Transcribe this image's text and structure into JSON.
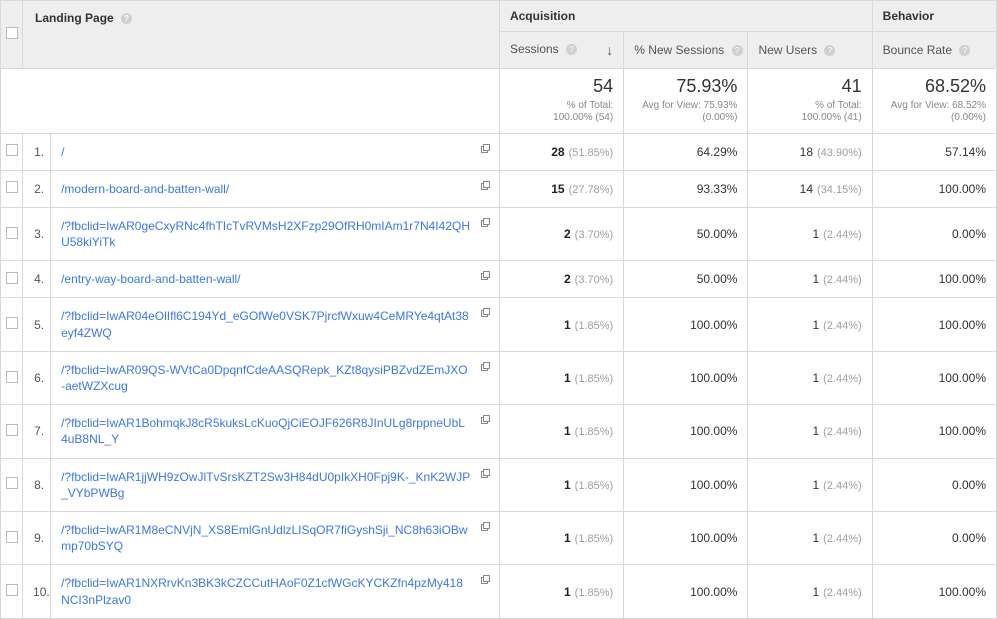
{
  "columns": {
    "dimension": "Landing Page",
    "group_acquisition": "Acquisition",
    "group_behavior": "Behavior",
    "sessions": "Sessions",
    "pct_new_sessions": "% New Sessions",
    "new_users": "New Users",
    "bounce_rate": "Bounce Rate",
    "help_glyph": "?"
  },
  "summary": {
    "sessions": {
      "big": "54",
      "line1": "% of Total:",
      "line2": "100.00% (54)"
    },
    "pct_new": {
      "big": "75.93%",
      "line1": "Avg for View: 75.93%",
      "line2": "(0.00%)"
    },
    "new_users": {
      "big": "41",
      "line1": "% of Total:",
      "line2": "100.00% (41)"
    },
    "bounce": {
      "big": "68.52%",
      "line1": "Avg for View: 68.52%",
      "line2": "(0.00%)"
    }
  },
  "rows": [
    {
      "n": "1.",
      "page": "/",
      "sessions_val": "28",
      "sessions_pct": "(51.85%)",
      "pct_new": "64.29%",
      "new_users_val": "18",
      "new_users_pct": "(43.90%)",
      "bounce": "57.14%"
    },
    {
      "n": "2.",
      "page": "/modern-board-and-batten-wall/",
      "sessions_val": "15",
      "sessions_pct": "(27.78%)",
      "pct_new": "93.33%",
      "new_users_val": "14",
      "new_users_pct": "(34.15%)",
      "bounce": "100.00%"
    },
    {
      "n": "3.",
      "page": "/?fbclid=IwAR0geCxyRNc4fhTIcTvRVMsH2XFzp29OfRH0mIAm1r7N4I42QHU58kiYiTk",
      "sessions_val": "2",
      "sessions_pct": "(3.70%)",
      "pct_new": "50.00%",
      "new_users_val": "1",
      "new_users_pct": "(2.44%)",
      "bounce": "0.00%"
    },
    {
      "n": "4.",
      "page": "/entry-way-board-and-batten-wall/",
      "sessions_val": "2",
      "sessions_pct": "(3.70%)",
      "pct_new": "50.00%",
      "new_users_val": "1",
      "new_users_pct": "(2.44%)",
      "bounce": "100.00%"
    },
    {
      "n": "5.",
      "page": "/?fbclid=IwAR04eOlIfl6C194Yd_eGOfWe0VSK7PjrcfWxuw4CeMRYe4qtAt38eyf4ZWQ",
      "sessions_val": "1",
      "sessions_pct": "(1.85%)",
      "pct_new": "100.00%",
      "new_users_val": "1",
      "new_users_pct": "(2.44%)",
      "bounce": "100.00%"
    },
    {
      "n": "6.",
      "page": "/?fbclid=IwAR09QS-WVtCa0DpqnfCdeAASQRepk_KZt8qysiPBZvdZEmJXO-aetWZXcug",
      "sessions_val": "1",
      "sessions_pct": "(1.85%)",
      "pct_new": "100.00%",
      "new_users_val": "1",
      "new_users_pct": "(2.44%)",
      "bounce": "100.00%"
    },
    {
      "n": "7.",
      "page": "/?fbclid=IwAR1BohmqkJ8cR5kuksLcKuoQjCiEOJF626R8JInULg8rppneUbL4uB8NL_Y",
      "sessions_val": "1",
      "sessions_pct": "(1.85%)",
      "pct_new": "100.00%",
      "new_users_val": "1",
      "new_users_pct": "(2.44%)",
      "bounce": "100.00%"
    },
    {
      "n": "8.",
      "page": "/?fbclid=IwAR1jjWH9zOwJlTvSrsKZT2Sw3H84dU0pIkXH0Fpj9K-_KnK2WJP_VYbPWBg",
      "sessions_val": "1",
      "sessions_pct": "(1.85%)",
      "pct_new": "100.00%",
      "new_users_val": "1",
      "new_users_pct": "(2.44%)",
      "bounce": "0.00%"
    },
    {
      "n": "9.",
      "page": "/?fbclid=IwAR1M8eCNVjN_XS8EmlGnUdlzLISqOR7fiGyshSji_NC8h63iOBwmp70bSYQ",
      "sessions_val": "1",
      "sessions_pct": "(1.85%)",
      "pct_new": "100.00%",
      "new_users_val": "1",
      "new_users_pct": "(2.44%)",
      "bounce": "0.00%"
    },
    {
      "n": "10.",
      "page": "/?fbclid=IwAR1NXRrvKn3BK3kCZCCutHAoF0Z1cfWGcKYCKZfn4pzMy418NCI3nPlzav0",
      "sessions_val": "1",
      "sessions_pct": "(1.85%)",
      "pct_new": "100.00%",
      "new_users_val": "1",
      "new_users_pct": "(2.44%)",
      "bounce": "100.00%"
    }
  ]
}
